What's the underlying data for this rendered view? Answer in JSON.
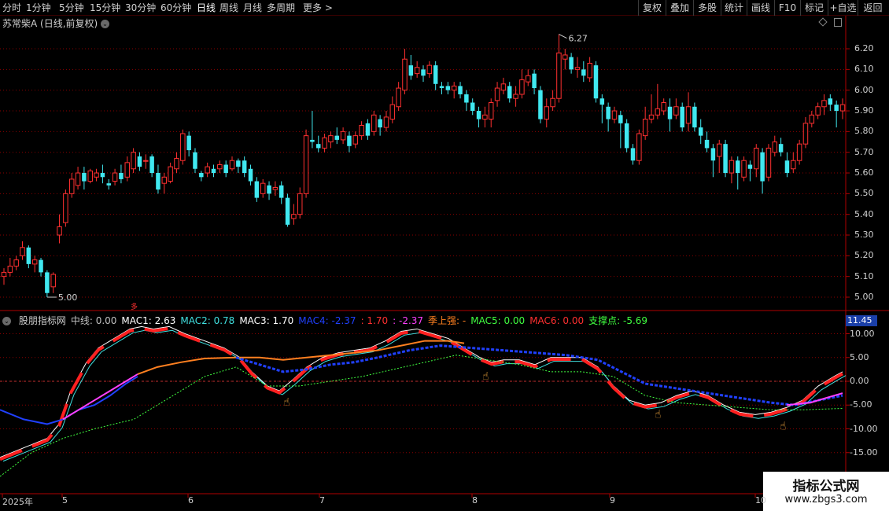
{
  "toolbar": {
    "timeframes": [
      {
        "label": "分时"
      },
      {
        "label": "1分钟"
      },
      {
        "label": "5分钟"
      },
      {
        "label": "15分钟"
      },
      {
        "label": "30分钟"
      },
      {
        "label": "60分钟"
      },
      {
        "label": "日线",
        "active": true
      },
      {
        "label": "周线"
      },
      {
        "label": "月线"
      },
      {
        "label": "多周期"
      },
      {
        "label": "更多 >"
      }
    ],
    "right_buttons": [
      {
        "label": "复权"
      },
      {
        "label": "叠加"
      },
      {
        "label": "多股"
      },
      {
        "label": "统计"
      },
      {
        "label": "画线"
      },
      {
        "label": "F10"
      },
      {
        "label": "标记"
      },
      {
        "label": "+自选"
      },
      {
        "label": "返回"
      }
    ]
  },
  "stock": {
    "title": "苏常柴A (日线,前复权)",
    "high_label": "6.27",
    "low_label": "5.00",
    "marker": "多"
  },
  "price_axis": [
    "6.20",
    "6.10",
    "6.00",
    "5.90",
    "5.80",
    "5.70",
    "5.60",
    "5.50",
    "5.40",
    "5.30",
    "5.20",
    "5.10",
    "5.00"
  ],
  "indicator": {
    "name": "股朋指标网",
    "items": [
      {
        "label": "中线: 0.00",
        "color": "#c0c0c0"
      },
      {
        "label": "MAC1: 2.63",
        "color": "#ffffff"
      },
      {
        "label": "MAC2: 0.78",
        "color": "#40e0e0"
      },
      {
        "label": "MAC3: 1.70",
        "color": "#ffffff"
      },
      {
        "label": "MAC4: -2.37",
        "color": "#2040ff"
      },
      {
        "label": ": 1.70",
        "color": "#ff3030"
      },
      {
        "label": ": -2.37",
        "color": "#ff40ff"
      },
      {
        "label": "季上强: -",
        "color": "#ff8020"
      },
      {
        "label": "MAC5: 0.00",
        "color": "#40ff40"
      },
      {
        "label": "MAC6: 0.00",
        "color": "#ff3030"
      },
      {
        "label": "支撑点: -5.69",
        "color": "#40ff40"
      }
    ],
    "current_value": "11.45",
    "axis": [
      "10.00",
      "5.00",
      "0.00",
      "-5.00",
      "-10.00",
      "-15.00"
    ]
  },
  "date_axis": [
    "2025年",
    "5",
    "6",
    "7",
    "8",
    "9",
    "10"
  ],
  "watermark": {
    "line1": "指标公式网",
    "line2": "www.zbgs3.com"
  },
  "colors": {
    "up": "#ff3030",
    "down": "#40e8f0",
    "grid": "#8a0000",
    "axis": "#b00000"
  },
  "chart_data": {
    "type": "candlestick",
    "candles_note": "daily OHLC, approx",
    "ylim": [
      4.96,
      6.3
    ],
    "candles": [
      [
        5.1,
        5.12,
        5.06,
        5.14
      ],
      [
        5.12,
        5.15,
        5.1,
        5.19
      ],
      [
        5.15,
        5.18,
        5.13,
        5.2
      ],
      [
        5.2,
        5.24,
        5.18,
        5.27
      ],
      [
        5.24,
        5.16,
        5.14,
        5.25
      ],
      [
        5.16,
        5.18,
        5.12,
        5.2
      ],
      [
        5.18,
        5.12,
        5.1,
        5.19
      ],
      [
        5.12,
        5.02,
        5.0,
        5.13
      ],
      [
        5.05,
        5.11,
        5.02,
        5.12
      ],
      [
        5.3,
        5.34,
        5.26,
        5.4
      ],
      [
        5.36,
        5.5,
        5.34,
        5.52
      ],
      [
        5.5,
        5.57,
        5.48,
        5.6
      ],
      [
        5.54,
        5.6,
        5.52,
        5.63
      ],
      [
        5.6,
        5.56,
        5.52,
        5.63
      ],
      [
        5.56,
        5.61,
        5.55,
        5.62
      ],
      [
        5.58,
        5.6,
        5.56,
        5.62
      ],
      [
        5.6,
        5.58,
        5.55,
        5.64
      ],
      [
        5.55,
        5.54,
        5.52,
        5.57
      ],
      [
        5.56,
        5.6,
        5.54,
        5.62
      ],
      [
        5.6,
        5.57,
        5.55,
        5.64
      ],
      [
        5.58,
        5.65,
        5.56,
        5.68
      ],
      [
        5.62,
        5.7,
        5.6,
        5.72
      ],
      [
        5.68,
        5.63,
        5.61,
        5.7
      ],
      [
        5.66,
        5.66,
        5.62,
        5.69
      ],
      [
        5.68,
        5.6,
        5.58,
        5.69
      ],
      [
        5.6,
        5.52,
        5.5,
        5.64
      ],
      [
        5.55,
        5.58,
        5.5,
        5.6
      ],
      [
        5.56,
        5.63,
        5.55,
        5.65
      ],
      [
        5.62,
        5.67,
        5.6,
        5.7
      ],
      [
        5.66,
        5.79,
        5.64,
        5.81
      ],
      [
        5.78,
        5.71,
        5.68,
        5.8
      ],
      [
        5.7,
        5.62,
        5.6,
        5.72
      ],
      [
        5.6,
        5.58,
        5.56,
        5.61
      ],
      [
        5.6,
        5.63,
        5.58,
        5.65
      ],
      [
        5.62,
        5.6,
        5.58,
        5.64
      ],
      [
        5.62,
        5.64,
        5.6,
        5.66
      ],
      [
        5.64,
        5.6,
        5.58,
        5.66
      ],
      [
        5.62,
        5.66,
        5.61,
        5.68
      ],
      [
        5.66,
        5.63,
        5.6,
        5.67
      ],
      [
        5.66,
        5.6,
        5.58,
        5.68
      ],
      [
        5.62,
        5.56,
        5.54,
        5.64
      ],
      [
        5.56,
        5.48,
        5.46,
        5.58
      ],
      [
        5.5,
        5.55,
        5.48,
        5.57
      ],
      [
        5.54,
        5.5,
        5.47,
        5.56
      ],
      [
        5.52,
        5.53,
        5.49,
        5.56
      ],
      [
        5.54,
        5.48,
        5.45,
        5.56
      ],
      [
        5.48,
        5.35,
        5.34,
        5.5
      ],
      [
        5.38,
        5.4,
        5.35,
        5.45
      ],
      [
        5.4,
        5.5,
        5.38,
        5.53
      ],
      [
        5.5,
        5.78,
        5.48,
        5.81
      ],
      [
        5.76,
        5.75,
        5.72,
        5.9
      ],
      [
        5.74,
        5.72,
        5.7,
        5.78
      ],
      [
        5.72,
        5.77,
        5.7,
        5.79
      ],
      [
        5.75,
        5.78,
        5.72,
        5.8
      ],
      [
        5.78,
        5.76,
        5.74,
        5.82
      ],
      [
        5.76,
        5.8,
        5.74,
        5.82
      ],
      [
        5.78,
        5.73,
        5.7,
        5.8
      ],
      [
        5.74,
        5.78,
        5.72,
        5.8
      ],
      [
        5.78,
        5.83,
        5.76,
        5.85
      ],
      [
        5.84,
        5.78,
        5.76,
        5.86
      ],
      [
        5.8,
        5.88,
        5.78,
        5.9
      ],
      [
        5.86,
        5.82,
        5.78,
        5.88
      ],
      [
        5.82,
        5.87,
        5.8,
        5.9
      ],
      [
        5.86,
        5.93,
        5.84,
        5.97
      ],
      [
        5.92,
        6.01,
        5.9,
        6.04
      ],
      [
        6.0,
        6.15,
        5.98,
        6.2
      ],
      [
        6.12,
        6.07,
        6.05,
        6.17
      ],
      [
        6.08,
        6.11,
        6.06,
        6.14
      ],
      [
        6.1,
        6.07,
        6.04,
        6.12
      ],
      [
        6.08,
        6.12,
        6.06,
        6.14
      ],
      [
        6.12,
        6.03,
        6.0,
        6.14
      ],
      [
        6.02,
        6.01,
        5.98,
        6.04
      ],
      [
        6.02,
        6.0,
        5.98,
        6.04
      ],
      [
        6.0,
        6.02,
        5.96,
        6.04
      ],
      [
        6.02,
        5.98,
        5.96,
        6.04
      ],
      [
        5.98,
        5.94,
        5.9,
        6.0
      ],
      [
        5.94,
        5.9,
        5.88,
        5.96
      ],
      [
        5.9,
        5.86,
        5.82,
        5.92
      ],
      [
        5.86,
        5.88,
        5.82,
        5.92
      ],
      [
        5.86,
        5.94,
        5.82,
        5.96
      ],
      [
        5.95,
        6.01,
        5.92,
        6.04
      ],
      [
        6.0,
        6.03,
        5.98,
        6.06
      ],
      [
        6.02,
        5.96,
        5.94,
        6.04
      ],
      [
        5.96,
        5.98,
        5.92,
        6.02
      ],
      [
        5.98,
        6.05,
        5.96,
        6.1
      ],
      [
        6.04,
        6.07,
        6.02,
        6.1
      ],
      [
        6.08,
        6.01,
        5.98,
        6.1
      ],
      [
        6.0,
        5.86,
        5.84,
        6.02
      ],
      [
        5.86,
        5.92,
        5.82,
        5.96
      ],
      [
        5.92,
        5.96,
        5.9,
        6.0
      ],
      [
        5.96,
        6.18,
        5.94,
        6.27
      ],
      [
        6.15,
        6.17,
        6.1,
        6.2
      ],
      [
        6.16,
        6.1,
        6.08,
        6.18
      ],
      [
        6.1,
        6.11,
        6.06,
        6.16
      ],
      [
        6.1,
        6.07,
        6.04,
        6.14
      ],
      [
        6.06,
        6.13,
        6.04,
        6.16
      ],
      [
        6.12,
        5.96,
        5.94,
        6.14
      ],
      [
        5.96,
        5.93,
        5.84,
        5.98
      ],
      [
        5.92,
        5.86,
        5.8,
        5.94
      ],
      [
        5.86,
        5.9,
        5.84,
        5.92
      ],
      [
        5.88,
        5.84,
        5.72,
        5.9
      ],
      [
        5.84,
        5.72,
        5.7,
        5.86
      ],
      [
        5.72,
        5.66,
        5.64,
        5.74
      ],
      [
        5.66,
        5.79,
        5.64,
        5.81
      ],
      [
        5.78,
        5.86,
        5.76,
        5.92
      ],
      [
        5.86,
        5.88,
        5.84,
        5.98
      ],
      [
        5.88,
        5.91,
        5.86,
        6.03
      ],
      [
        5.9,
        5.94,
        5.88,
        5.96
      ],
      [
        5.92,
        5.86,
        5.8,
        5.96
      ],
      [
        5.88,
        5.92,
        5.86,
        5.96
      ],
      [
        5.92,
        5.82,
        5.8,
        5.94
      ],
      [
        5.84,
        5.92,
        5.8,
        5.99
      ],
      [
        5.92,
        5.82,
        5.8,
        5.94
      ],
      [
        5.82,
        5.78,
        5.74,
        5.86
      ],
      [
        5.76,
        5.72,
        5.7,
        5.8
      ],
      [
        5.72,
        5.66,
        5.58,
        5.74
      ],
      [
        5.68,
        5.74,
        5.6,
        5.76
      ],
      [
        5.74,
        5.6,
        5.58,
        5.76
      ],
      [
        5.6,
        5.66,
        5.55,
        5.68
      ],
      [
        5.66,
        5.6,
        5.52,
        5.68
      ],
      [
        5.58,
        5.66,
        5.56,
        5.68
      ],
      [
        5.64,
        5.62,
        5.56,
        5.66
      ],
      [
        5.62,
        5.72,
        5.58,
        5.74
      ],
      [
        5.7,
        5.56,
        5.5,
        5.72
      ],
      [
        5.58,
        5.72,
        5.56,
        5.74
      ],
      [
        5.7,
        5.75,
        5.68,
        5.78
      ],
      [
        5.74,
        5.7,
        5.68,
        5.77
      ],
      [
        5.66,
        5.6,
        5.58,
        5.7
      ],
      [
        5.62,
        5.66,
        5.6,
        5.7
      ],
      [
        5.66,
        5.74,
        5.64,
        5.76
      ],
      [
        5.74,
        5.84,
        5.72,
        5.87
      ],
      [
        5.84,
        5.88,
        5.82,
        5.9
      ],
      [
        5.88,
        5.92,
        5.86,
        5.94
      ],
      [
        5.92,
        5.95,
        5.88,
        5.98
      ],
      [
        5.96,
        5.93,
        5.9,
        5.98
      ],
      [
        5.93,
        5.9,
        5.82,
        5.95
      ],
      [
        5.9,
        5.93,
        5.86,
        5.96
      ]
    ]
  }
}
